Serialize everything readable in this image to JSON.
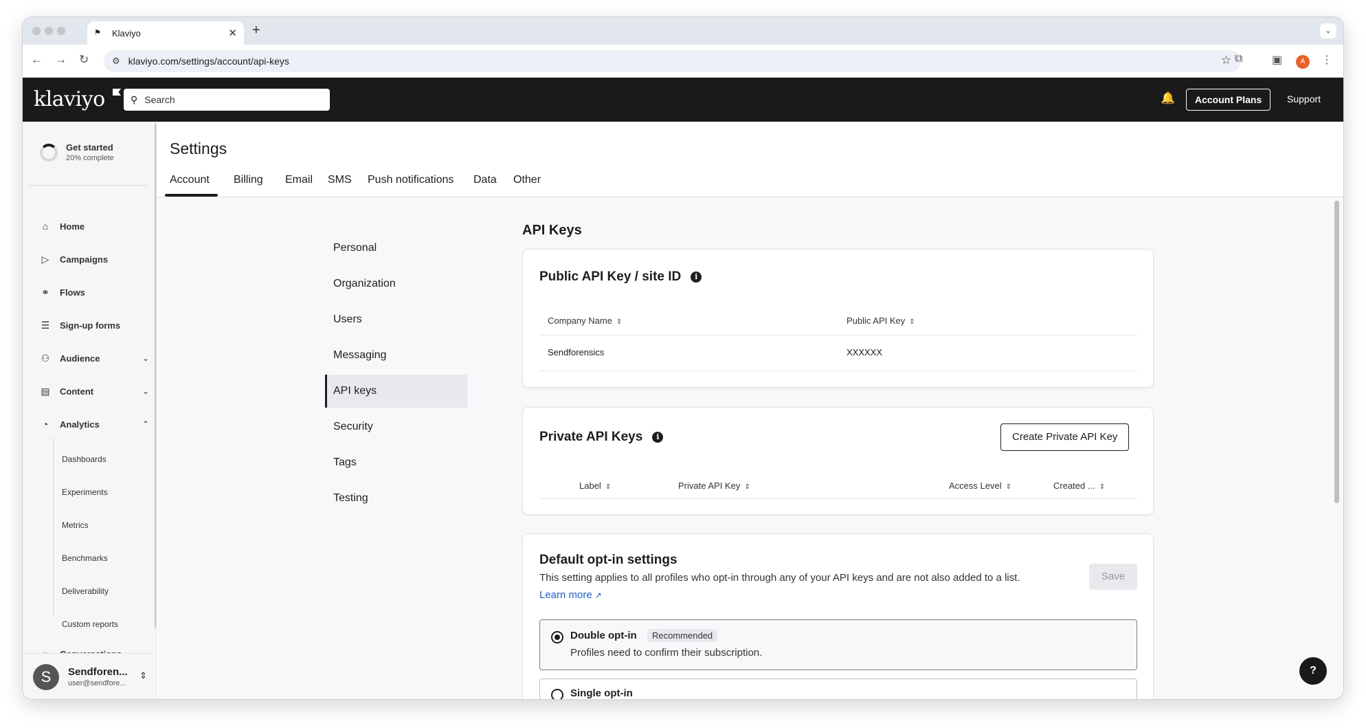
{
  "browser": {
    "tab_title": "Klaviyo",
    "url": "klaviyo.com/settings/account/api-keys",
    "profile_initial": "A"
  },
  "header": {
    "logo": "klaviyo",
    "search_placeholder": "Search",
    "account_plans": "Account Plans",
    "support": "Support"
  },
  "sidebar": {
    "get_started_title": "Get started",
    "get_started_progress": "20% complete",
    "progress_percent": 20,
    "items": [
      {
        "label": "Home",
        "icon": "home-icon"
      },
      {
        "label": "Campaigns",
        "icon": "send-icon"
      },
      {
        "label": "Flows",
        "icon": "flows-icon"
      },
      {
        "label": "Sign-up forms",
        "icon": "form-icon"
      },
      {
        "label": "Audience",
        "icon": "people-icon"
      },
      {
        "label": "Content",
        "icon": "content-icon"
      },
      {
        "label": "Analytics",
        "icon": "analytics-icon"
      }
    ],
    "analytics_sub": [
      "Dashboards",
      "Experiments",
      "Metrics",
      "Benchmarks",
      "Deliverability",
      "Custom reports"
    ],
    "conversations": "Conversations",
    "user_name": "Sendforen...",
    "user_initial": "S",
    "user_email": "user@sendfore..."
  },
  "settings": {
    "title": "Settings",
    "tabs": [
      "Account",
      "Billing",
      "Email",
      "SMS",
      "Push notifications",
      "Data",
      "Other"
    ],
    "subnav": [
      "Personal",
      "Organization",
      "Users",
      "Messaging",
      "API keys",
      "Security",
      "Tags",
      "Testing"
    ],
    "active_subnav": "API keys"
  },
  "api_keys": {
    "title": "API Keys",
    "public": {
      "title": "Public API Key / site ID",
      "col_company": "Company Name",
      "col_key": "Public API Key",
      "company": "Sendforensics",
      "key": "XXXXXX"
    },
    "private": {
      "title": "Private API Keys",
      "create_button": "Create Private API Key",
      "col_label": "Label",
      "col_key": "Private API Key",
      "col_access": "Access Level",
      "col_created": "Created ..."
    },
    "optin": {
      "title": "Default opt-in settings",
      "description": "This setting applies to all profiles who opt-in through any of your API keys and are not also added to a list.",
      "learn_more": "Learn more",
      "save": "Save",
      "double_title": "Double opt-in",
      "double_badge": "Recommended",
      "double_desc": "Profiles need to confirm their subscription.",
      "single_title": "Single opt-in"
    }
  },
  "help_label": "?"
}
